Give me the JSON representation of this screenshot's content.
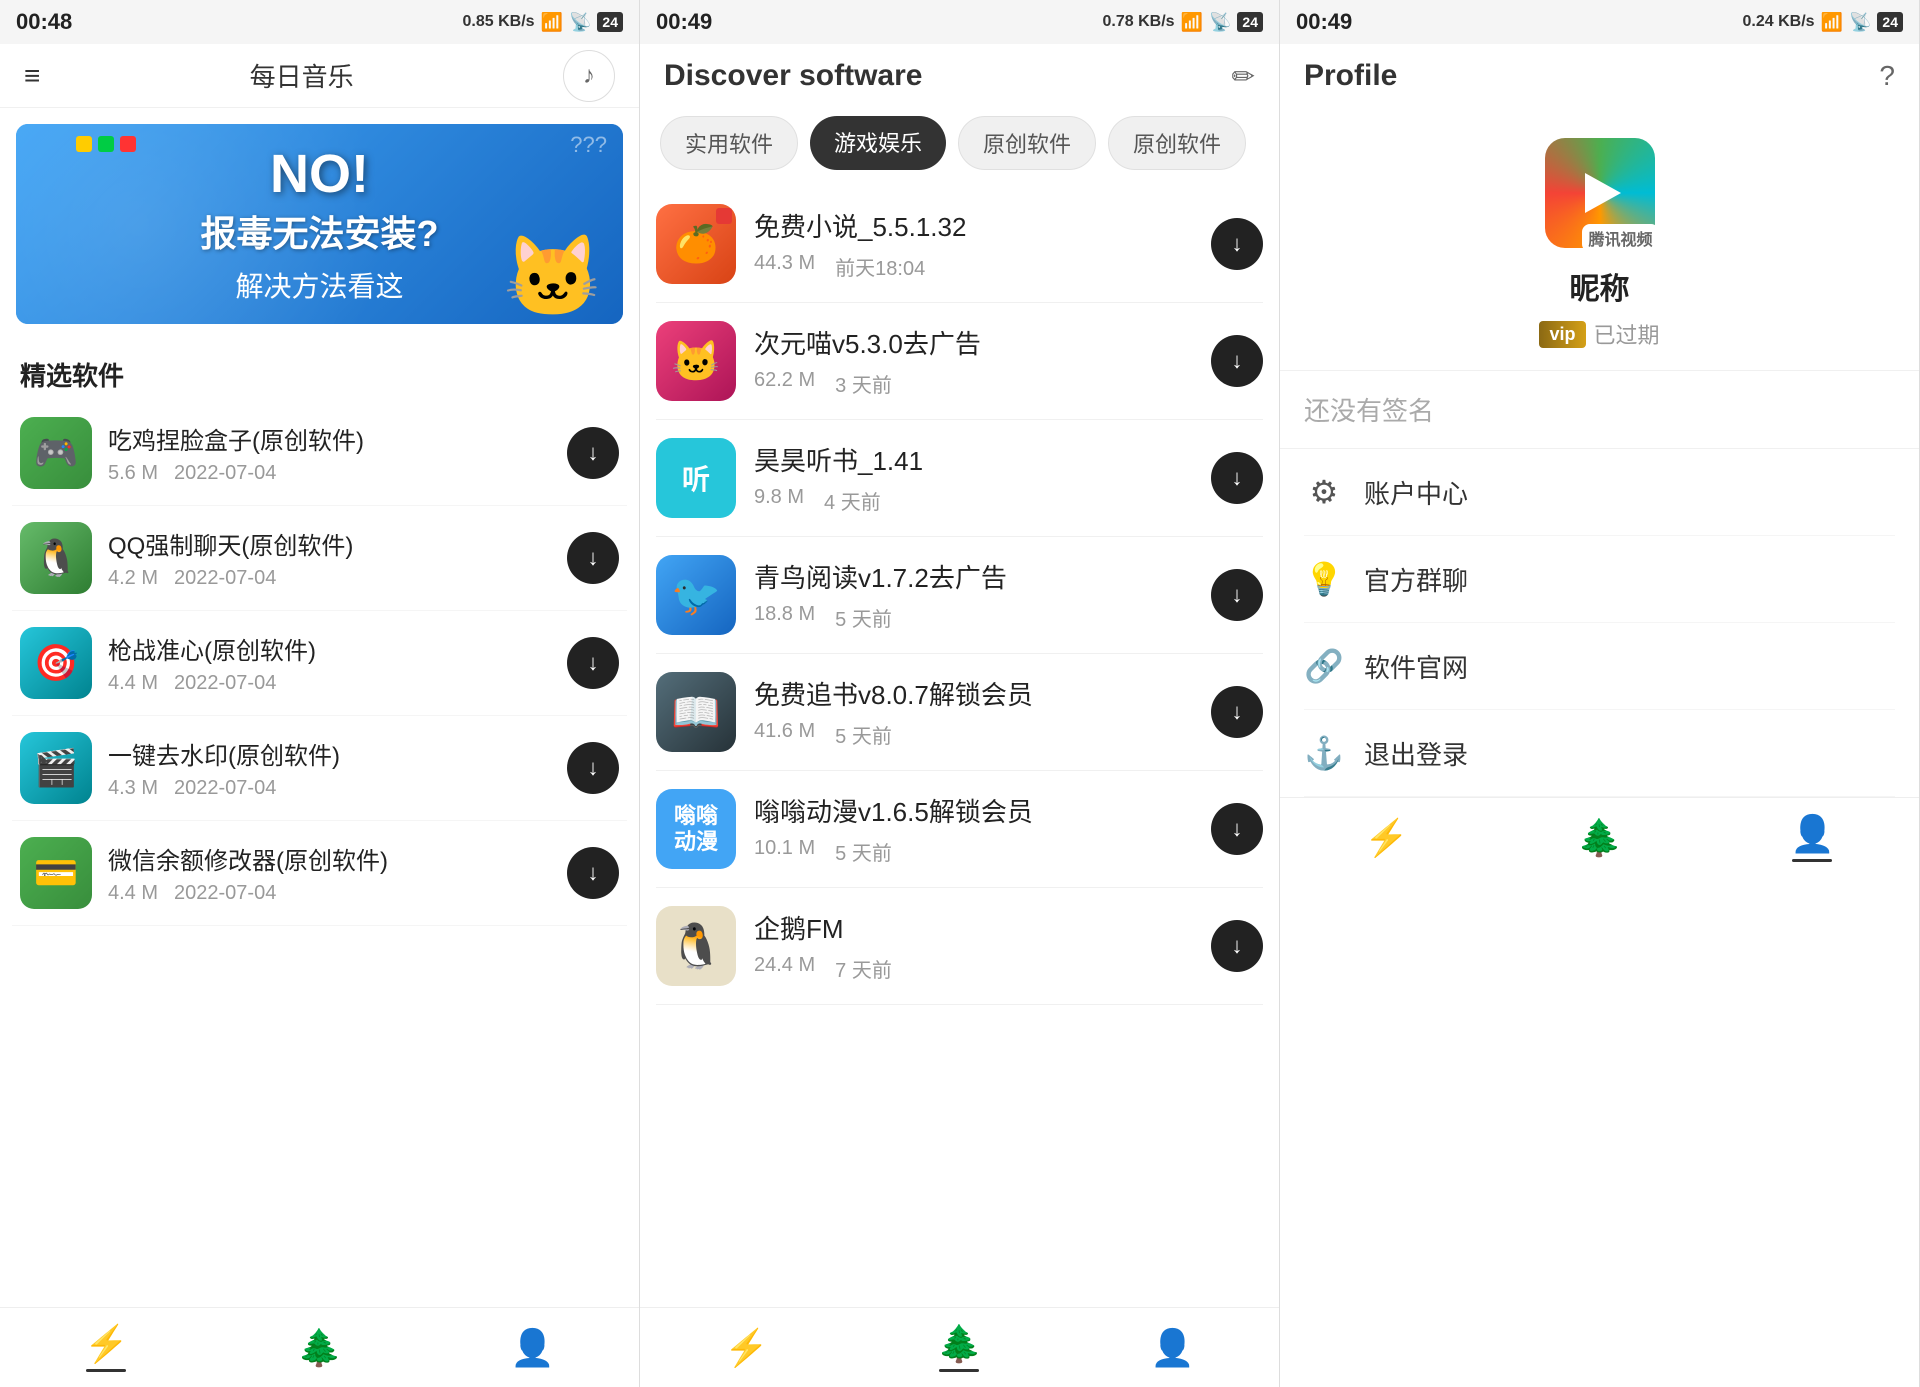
{
  "panels": {
    "music": {
      "status": {
        "time": "00:48",
        "network": "0.85 KB/s",
        "battery": "24"
      },
      "title": "每日音乐",
      "section": "精选软件",
      "banner": {
        "no_text": "NO!",
        "main_text": "报毒无法安装?",
        "sub_text": "解决方法看这"
      },
      "apps": [
        {
          "name": "吃鸡捏脸盒子(原创软件)",
          "size": "5.6 M",
          "date": "2022-07-04",
          "color": "icon-green-1"
        },
        {
          "name": "QQ强制聊天(原创软件)",
          "size": "4.2 M",
          "date": "2022-07-04",
          "color": "icon-green-2"
        },
        {
          "name": "枪战准心(原创软件)",
          "size": "4.4 M",
          "date": "2022-07-04",
          "color": "icon-teal"
        },
        {
          "name": "一键去水印(原创软件)",
          "size": "4.3 M",
          "date": "2022-07-04",
          "color": "icon-cyan"
        },
        {
          "name": "微信余额修改器(原创软件)",
          "size": "4.4 M",
          "date": "2022-07-04",
          "color": "icon-green-1"
        }
      ],
      "nav": [
        "⚡",
        "🌲",
        "👤"
      ]
    },
    "discover": {
      "status": {
        "time": "00:49",
        "network": "0.78 KB/s",
        "battery": "24"
      },
      "title": "Discover software",
      "tabs": [
        {
          "label": "实用软件",
          "active": false
        },
        {
          "label": "游戏娱乐",
          "active": true
        },
        {
          "label": "原创软件",
          "active": false
        },
        {
          "label": "原创软件",
          "active": false
        }
      ],
      "apps": [
        {
          "name": "免费小说_5.5.1.32",
          "size": "44.3 M",
          "date": "前天18:04",
          "color": "icon-orange",
          "emoji": "📕"
        },
        {
          "name": "次元喵v5.3.0去广告",
          "size": "62.2 M",
          "date": "3 天前",
          "color": "icon-pink",
          "emoji": "🐱"
        },
        {
          "name": "昊昊听书_1.41",
          "size": "9.8 M",
          "date": "4 天前",
          "color": "icon-teal",
          "emoji": "🎧"
        },
        {
          "name": "青鸟阅读v1.7.2去广告",
          "size": "18.8 M",
          "date": "5 天前",
          "color": "icon-blue",
          "emoji": "🐦"
        },
        {
          "name": "免费追书v8.0.7解锁会员",
          "size": "41.6 M",
          "date": "5 天前",
          "color": "icon-dark",
          "emoji": "📖"
        },
        {
          "name": "嗡嗡动漫v1.6.5解锁会员",
          "size": "10.1 M",
          "date": "5 天前",
          "color": "icon-cyan",
          "emoji": "🎭"
        },
        {
          "name": "企鹅FM",
          "size": "24.4 M",
          "date": "7 天前",
          "color": "icon-amber",
          "emoji": "🐧"
        }
      ],
      "nav": [
        "⚡",
        "🌲",
        "👤"
      ]
    },
    "profile": {
      "status": {
        "time": "00:49",
        "network": "0.24 KB/s",
        "battery": "24"
      },
      "title": "Profile",
      "nickname": "昵称",
      "vip_label": "vip",
      "vip_status": "已过期",
      "no_signature": "还没有签名",
      "menu_items": [
        {
          "icon": "⚙️",
          "label": "账户中心"
        },
        {
          "icon": "💡",
          "label": "官方群聊"
        },
        {
          "icon": "🔗",
          "label": "软件官网"
        },
        {
          "icon": "⚓",
          "label": "退出登录"
        }
      ],
      "nav": [
        "⚡",
        "🌲",
        "👤"
      ]
    }
  }
}
